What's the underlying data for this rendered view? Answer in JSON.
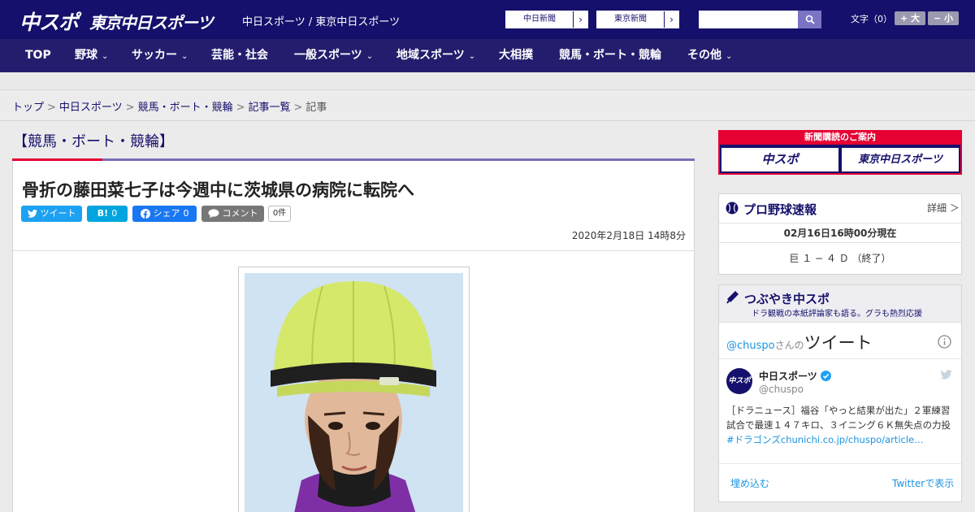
{
  "header": {
    "logo_main": "中スポ",
    "logo_tokyo": "東京中日スポーツ",
    "tagline": "中日スポーツ / 東京中日スポーツ",
    "newspaper_links": [
      "中日新聞",
      "東京新聞"
    ],
    "arrow": "›",
    "search_placeholder": "",
    "font_size_label": "文字（0）",
    "font_plus": "+ 大",
    "font_minus": "− 小"
  },
  "nav": {
    "items": [
      {
        "label": "TOP",
        "has_menu": false
      },
      {
        "label": "野球",
        "has_menu": true
      },
      {
        "label": "サッカー",
        "has_menu": true
      },
      {
        "label": "芸能・社会",
        "has_menu": false
      },
      {
        "label": "一般スポーツ",
        "has_menu": true
      },
      {
        "label": "地域スポーツ",
        "has_menu": true
      },
      {
        "label": "大相撲",
        "has_menu": false
      },
      {
        "label": "競馬・ボート・競輪",
        "has_menu": false
      },
      {
        "label": "その他",
        "has_menu": true
      }
    ],
    "chevron": "⌄"
  },
  "breadcrumb": {
    "items": [
      "トップ",
      "中日スポーツ",
      "競馬・ボート・競輪",
      "記事一覧",
      "記事"
    ],
    "separator": ">"
  },
  "article": {
    "section_title": "【競馬・ボート・競輪】",
    "headline": "骨折の藤田菜七子は今週中に茨城県の病院に転院へ",
    "share": {
      "tweet": "ツイート",
      "hatena": "B!",
      "hatena_count": "0",
      "facebook": "シェア",
      "facebook_count": "0",
      "comment": "コメント",
      "comment_count": "0件"
    },
    "date": "2020年2月18日 14時8分"
  },
  "sidebar": {
    "promo": {
      "title": "新聞購読のご案内",
      "btn1": "中スポ",
      "btn2": "東京中日スポーツ"
    },
    "baseball": {
      "title": "プロ野球速報",
      "detail": "詳細 ＞",
      "as_of": "02月16日16時00分現在",
      "score": "巨 １ − ４ Ｄ （終了）"
    },
    "tweets": {
      "title": "つぶやき中スポ",
      "subtitle": "ドラ観戦の本紙評論家も語る。グラも熱烈応援",
      "handle_prefix": "@chuspo",
      "handle_suffix": "さんの",
      "tweet_word": "ツイート",
      "account_name": "中日スポーツ",
      "account_handle": "@chuspo",
      "tweet_text_part1": "［ドラニュース］福谷「やっと結果が出た」２軍練習試合で最速１４７キロ、３イニング６Ｋ無失点の力投",
      "tweet_link": "#ドラゴンズchunichi.co.jp/chuspo/article…",
      "embed": "埋め込む",
      "view_on": "Twitterで表示",
      "avatar_text": "中スポ"
    }
  },
  "colors": {
    "header_bg": "#15106b",
    "nav_bg": "#241d6e",
    "accent_red": "#e60033",
    "twitter": "#1da1f2",
    "hatena": "#00a4de",
    "facebook": "#1877f2",
    "comment_gray": "#777777"
  }
}
